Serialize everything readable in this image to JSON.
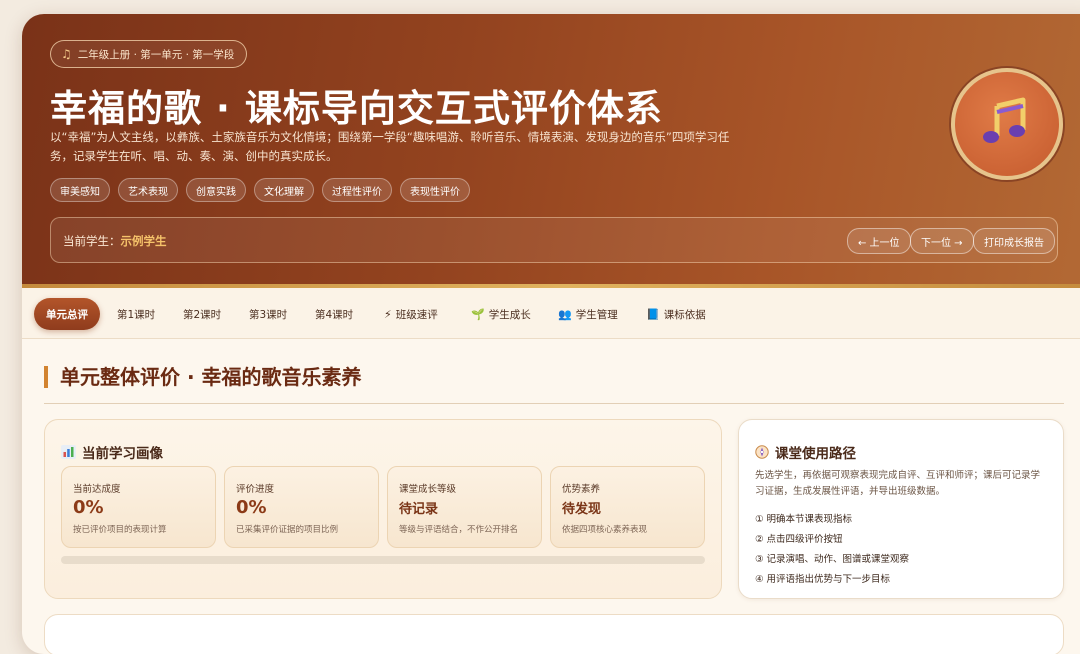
{
  "hero": {
    "crumb": "二年级上册 · 第一单元 · 第一学段",
    "crumb_icon": "music-note-icon",
    "title": "幸福的歌 · 课标导向交互式评价体系",
    "description": "以“幸福”为人文主线，以彝族、土家族音乐为文化情境；围绕第一学段“趣味唱游、聆听音乐、情境表演、发现身边的音乐”四项学习任务，记录学生在听、唱、动、奏、演、创中的真实成长。",
    "tags": [
      "审美感知",
      "艺术表现",
      "创意实践",
      "文化理解",
      "过程性评价",
      "表现性评价"
    ],
    "student_label": "当前学生：",
    "student_name": "示例学生",
    "prev_button": "← 上一位",
    "next_button": "下一位 →",
    "print_button": "打印成长报告",
    "logo_icon": "music-notes-icon"
  },
  "tabs": [
    {
      "label": "单元总评",
      "icon": "",
      "active": true
    },
    {
      "label": "第1课时",
      "icon": ""
    },
    {
      "label": "第2课时",
      "icon": ""
    },
    {
      "label": "第3课时",
      "icon": ""
    },
    {
      "label": "第4课时",
      "icon": ""
    },
    {
      "label": "班级速评",
      "icon": "⚡"
    },
    {
      "label": "学生成长",
      "icon": "🌱"
    },
    {
      "label": "学生管理",
      "icon": "👥"
    },
    {
      "label": "课标依据",
      "icon": "📘"
    }
  ],
  "section": {
    "title": "单元整体评价 · 幸福的歌音乐素养"
  },
  "portrait": {
    "title": "当前学习画像",
    "icon": "bar-chart-icon",
    "metrics": [
      {
        "label": "当前达成度",
        "value": "0%",
        "note": "按已评价项目的表现计算"
      },
      {
        "label": "评价进度",
        "value": "0%",
        "note": "已采集评价证据的项目比例"
      },
      {
        "label": "课堂成长等级",
        "value": "待记录",
        "note": "等级与评语结合，不作公开排名"
      },
      {
        "label": "优势素养",
        "value": "待发现",
        "note": "依据四项核心素养表现"
      }
    ],
    "progress": 0
  },
  "usage": {
    "title": "课堂使用路径",
    "icon": "compass-icon",
    "description": "先选学生，再依据可观察表现完成自评、互评和师评；课后可记录学习证据，生成发展性评语，并导出班级数据。",
    "steps": [
      "① 明确本节课表现指标",
      "② 点击四级评价按钮",
      "③ 记录演唱、动作、图谱或课堂观察",
      "④ 用评语指出优势与下一步目标"
    ]
  },
  "colors": {
    "accent": "#8f3c1d",
    "gold": "#d2832f",
    "hero_start": "#7a3218",
    "hero_end": "#b36a35"
  }
}
